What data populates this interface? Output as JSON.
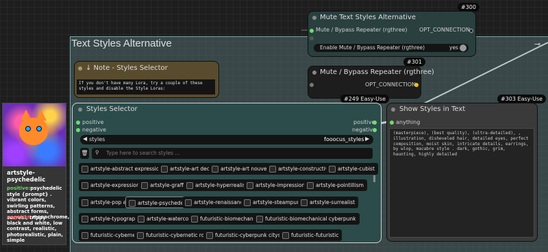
{
  "group": {
    "title": "Text Styles Alternative",
    "pin_icon": "pin-icon"
  },
  "preview": {
    "name": "artstyle-psychedelic",
    "positive_label": "positive:",
    "positive_text": "psychedelic style {prompt} . vibrant colors, swirling patterns, abstract forms, surreal, trippy",
    "negative_label": "negative:",
    "negative_text": "monochrome, black and white, low contrast, realistic, photorealistic, plain, simple"
  },
  "mute_node": {
    "badge": "#300",
    "title": "Mute Text Styles Alternative",
    "input": "Mute / Bypass Repeater (rgthree)",
    "output": "OPT_CONNECTION",
    "toggle_label": "Enable Mute / Bypass Repeater (rgthree)",
    "toggle_value": "yes"
  },
  "bypass_node": {
    "badge": "#301",
    "title": "Mute / Bypass Repeater (rgthree)",
    "output": "OPT_CONNECTION"
  },
  "note_node": {
    "title": "↓ Note - Styles Selector",
    "text": "If you don't have many Lora, try a couple of these styles and disable the Style Loras:"
  },
  "styles_node": {
    "badge": "#249 Easy-Use",
    "title": "Styles Selector",
    "inputs": [
      "positive",
      "negative"
    ],
    "outputs": [
      "positive",
      "negative"
    ],
    "combo_label": "styles",
    "combo_value": "fooocus_styles",
    "search_placeholder": "Type here to search styles ...",
    "chips": [
      "artstyle-abstract expressionism",
      "artstyle-art deco",
      "artstyle-art nouveau",
      "artstyle-constructivist",
      "artstyle-cubist",
      "artstyle-expressionist",
      "artstyle-graffiti",
      "artstyle-hyperrealism",
      "artstyle-impressionist",
      "artstyle-pointillism",
      "artstyle-pop art",
      "artstyle-psychedelic",
      "artstyle-renaissance",
      "artstyle-steampunk",
      "artstyle-surrealist",
      "artstyle-typography",
      "artstyle-watercolor",
      "futuristic-biomechanical",
      "futuristic-biomechanical cyberpunk",
      "futuristic-cybernetic",
      "futuristic-cybernetic robot",
      "futuristic-cyberpunk cityscape",
      "futuristic-futuristic"
    ]
  },
  "show_node": {
    "badge": "#303 Easy-Use",
    "title": "Show Styles in Text",
    "input": "anything",
    "text": "(masterpiece), (best quality), (ultra-detailed), , illustration, disheveled hair, detailed eyes, perfect composition, moist skin, intricate details, earrings, by wlop, macabre style  . dark, gothic, grim, haunting, highly detailed"
  },
  "colors": {
    "group": "#5f8082",
    "node_teal": "#2b4c4a",
    "link": "#ffffff"
  }
}
